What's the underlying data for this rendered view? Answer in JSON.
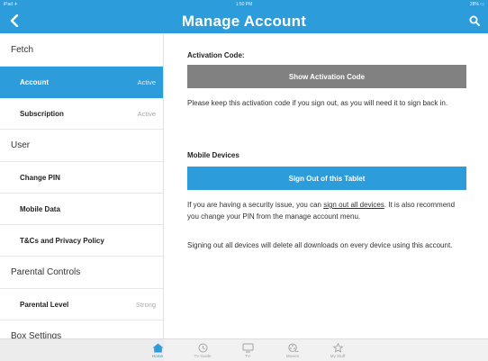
{
  "status_bar": {
    "carrier": "iPad ✈",
    "time": "1:50 PM",
    "battery": "28% ▭"
  },
  "header": {
    "title": "Manage Account"
  },
  "sidebar": {
    "sections": [
      {
        "header": "Fetch",
        "items": [
          {
            "label": "Account",
            "value": "Active",
            "selected": true
          },
          {
            "label": "Subscription",
            "value": "Active"
          }
        ]
      },
      {
        "header": "User",
        "items": [
          {
            "label": "Change PIN"
          },
          {
            "label": "Mobile Data"
          },
          {
            "label": "T&Cs and Privacy Policy"
          }
        ]
      },
      {
        "header": "Parental Controls",
        "items": [
          {
            "label": "Parental Level",
            "value": "Strong"
          }
        ]
      },
      {
        "header": "Box Settings",
        "items": []
      }
    ]
  },
  "main": {
    "activation_heading": "Activation Code:",
    "show_code_button": "Show Activation Code",
    "activation_note": "Please keep this activation code if you sign out, as you will need it to sign back in.",
    "mobile_devices_heading": "Mobile Devices",
    "sign_out_button": "Sign Out of this Tablet",
    "security_note_before": "If you are having a security issue, you can ",
    "security_note_link": "sign out all devices",
    "security_note_after": ". It is also recommend you change your PIN from the manage account menu.",
    "sign_out_all_note": "Signing out all devices will delete all downloads on every device using this account."
  },
  "tabbar": {
    "tabs": [
      {
        "label": "Home",
        "icon": "home-icon",
        "active": true
      },
      {
        "label": "TV Guide",
        "icon": "clock-icon"
      },
      {
        "label": "TV",
        "icon": "tv-icon"
      },
      {
        "label": "Movies",
        "icon": "film-reel-icon"
      },
      {
        "label": "My Stuff",
        "icon": "star-icon"
      }
    ]
  },
  "colors": {
    "brand": "#2d9cdb",
    "grey_button": "#818181"
  }
}
